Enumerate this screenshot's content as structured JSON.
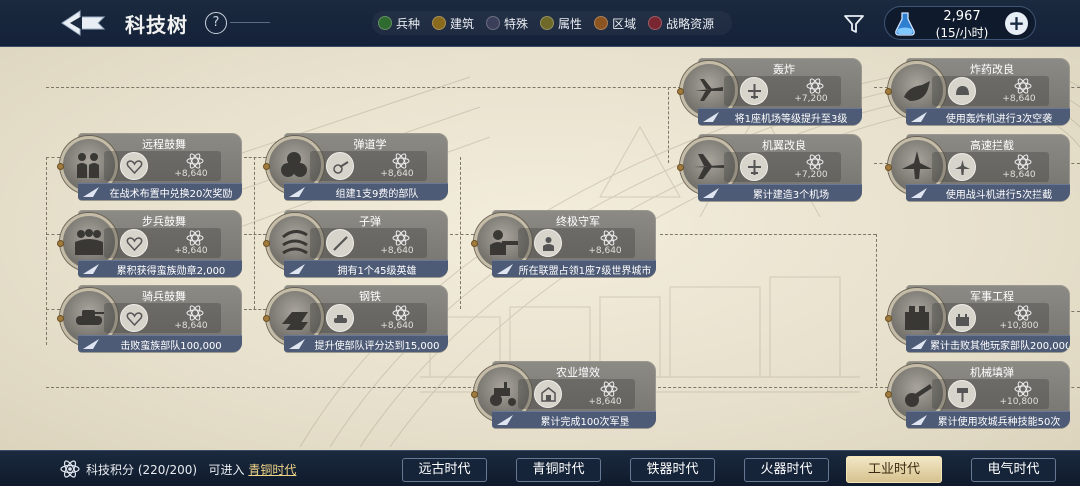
{
  "header": {
    "title": "科技树",
    "help_symbol": "?",
    "legend": [
      {
        "label": "兵种",
        "color": "#2f6a2f"
      },
      {
        "label": "建筑",
        "color": "#8a6a1d"
      },
      {
        "label": "特殊",
        "color": "#3b3f59"
      },
      {
        "label": "属性",
        "color": "#6f6a2a"
      },
      {
        "label": "区域",
        "color": "#8c5420"
      },
      {
        "label": "战略资源",
        "color": "#7a2632"
      }
    ],
    "resource": {
      "value": "2,967",
      "rate": "(15/小时)"
    }
  },
  "nodes": [
    {
      "name": "远程鼓舞",
      "points": "+8,640",
      "condition": "在战术布置中兑换20次奖励",
      "icon": "heart-shield-icon"
    },
    {
      "name": "步兵鼓舞",
      "points": "+8,640",
      "condition": "累积获得蛮族勋章2,000",
      "icon": "heart-shield-icon"
    },
    {
      "name": "骑兵鼓舞",
      "points": "+8,640",
      "condition": "击败蛮族部队100,000",
      "icon": "heart-shield-icon"
    },
    {
      "name": "弹道学",
      "points": "+8,640",
      "condition": "组建1支9费的部队",
      "icon": "cannon-icon"
    },
    {
      "name": "子弹",
      "points": "+8,640",
      "condition": "拥有1个45级英雄",
      "icon": "rifle-icon"
    },
    {
      "name": "钢铁",
      "points": "+8,640",
      "condition": "提升使部队评分达到15,000",
      "icon": "tank-icon"
    },
    {
      "name": "终极守军",
      "points": "+8,640",
      "condition": "所在联盟占领1座7级世界城市",
      "icon": "soldier-icon"
    },
    {
      "name": "农业增效",
      "points": "+8,640",
      "condition": "累计完成100次军垦",
      "icon": "farm-icon"
    },
    {
      "name": "轰炸",
      "points": "+7,200",
      "condition": "将1座机场等级提升至3级",
      "icon": "plane-icon"
    },
    {
      "name": "机翼改良",
      "points": "+7,200",
      "condition": "累计建造3个机场",
      "icon": "plane-icon"
    },
    {
      "name": "炸药改良",
      "points": "+8,640",
      "condition": "使用轰炸机进行3次空袭",
      "icon": "helmet-icon"
    },
    {
      "name": "高速拦截",
      "points": "+8,640",
      "condition": "使用战斗机进行5次拦截",
      "icon": "fighter-icon"
    },
    {
      "name": "军事工程",
      "points": "+10,800",
      "condition": "累计击败其他玩家部队200,000",
      "icon": "fort-icon"
    },
    {
      "name": "机械填弹",
      "points": "+10,800",
      "condition": "累计使用攻城兵种技能50次",
      "icon": "hammer-icon"
    }
  ],
  "footer": {
    "score_label": "科技积分",
    "score_value": "(220/200)",
    "enter_text": "可进入",
    "enter_era": "青铜时代",
    "eras": [
      "远古时代",
      "青铜时代",
      "铁器时代",
      "火器时代",
      "工业时代",
      "电气时代"
    ],
    "active_era": "工业时代"
  }
}
